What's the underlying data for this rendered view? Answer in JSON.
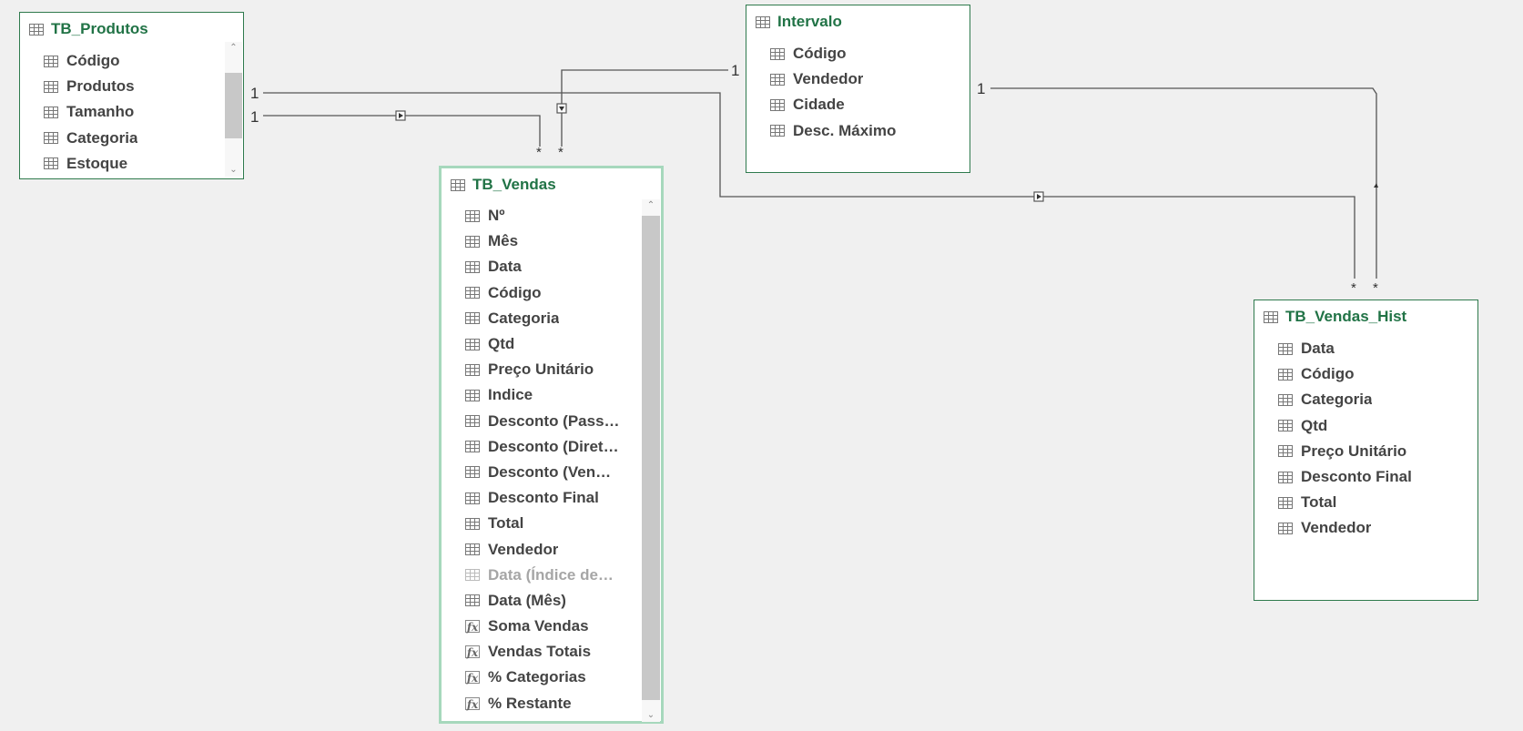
{
  "relationships": {
    "produtos_vendas_hist_one": "1",
    "produtos_vendas_one": "1",
    "intervalo_vendas_one": "1",
    "intervalo_hist_one": "1",
    "vendas_many_a": "*",
    "vendas_many_b": "*",
    "hist_many_a": "*",
    "hist_many_b": "*"
  },
  "tables": {
    "tb_produtos": {
      "title": "TB_Produtos",
      "fields": [
        "Código",
        "Produtos",
        "Tamanho",
        "Categoria",
        "Estoque"
      ]
    },
    "intervalo": {
      "title": "Intervalo",
      "fields": [
        "Código",
        "Vendedor",
        "Cidade",
        "Desc. Máximo"
      ]
    },
    "tb_vendas": {
      "title": "TB_Vendas",
      "fields": [
        {
          "label": "Nº",
          "kind": "column"
        },
        {
          "label": "Mês",
          "kind": "column"
        },
        {
          "label": "Data",
          "kind": "column"
        },
        {
          "label": "Código",
          "kind": "column"
        },
        {
          "label": "Categoria",
          "kind": "column"
        },
        {
          "label": "Qtd",
          "kind": "column"
        },
        {
          "label": "Preço Unitário",
          "kind": "column"
        },
        {
          "label": "Indice",
          "kind": "column"
        },
        {
          "label": "Desconto  (Pass…",
          "kind": "column"
        },
        {
          "label": "Desconto  (Diret…",
          "kind": "column"
        },
        {
          "label": "Desconto  (Ven…",
          "kind": "column"
        },
        {
          "label": "Desconto Final",
          "kind": "column"
        },
        {
          "label": "Total",
          "kind": "column"
        },
        {
          "label": "Vendedor",
          "kind": "column"
        },
        {
          "label": "Data (Índice de…",
          "kind": "hidden"
        },
        {
          "label": "Data (Mês)",
          "kind": "column"
        },
        {
          "label": "Soma Vendas",
          "kind": "measure"
        },
        {
          "label": "Vendas Totais",
          "kind": "measure"
        },
        {
          "label": "% Categorias",
          "kind": "measure"
        },
        {
          "label": "% Restante",
          "kind": "measure"
        }
      ]
    },
    "tb_vendas_hist": {
      "title": "TB_Vendas_Hist",
      "fields": [
        "Data",
        "Código",
        "Categoria",
        "Qtd",
        "Preço Unitário",
        "Desconto Final",
        "Total",
        "Vendedor"
      ]
    }
  },
  "colors": {
    "title_green": "#217346",
    "card_border": "#2f7a4d",
    "selected_border": "#a6d8bc",
    "canvas": "#f0f0f0",
    "line": "#555555"
  },
  "icons": {
    "column": "table-column-icon",
    "measure": "fx-measure-icon",
    "table": "table-icon",
    "filter_direction": "arrow-marker-icon"
  }
}
